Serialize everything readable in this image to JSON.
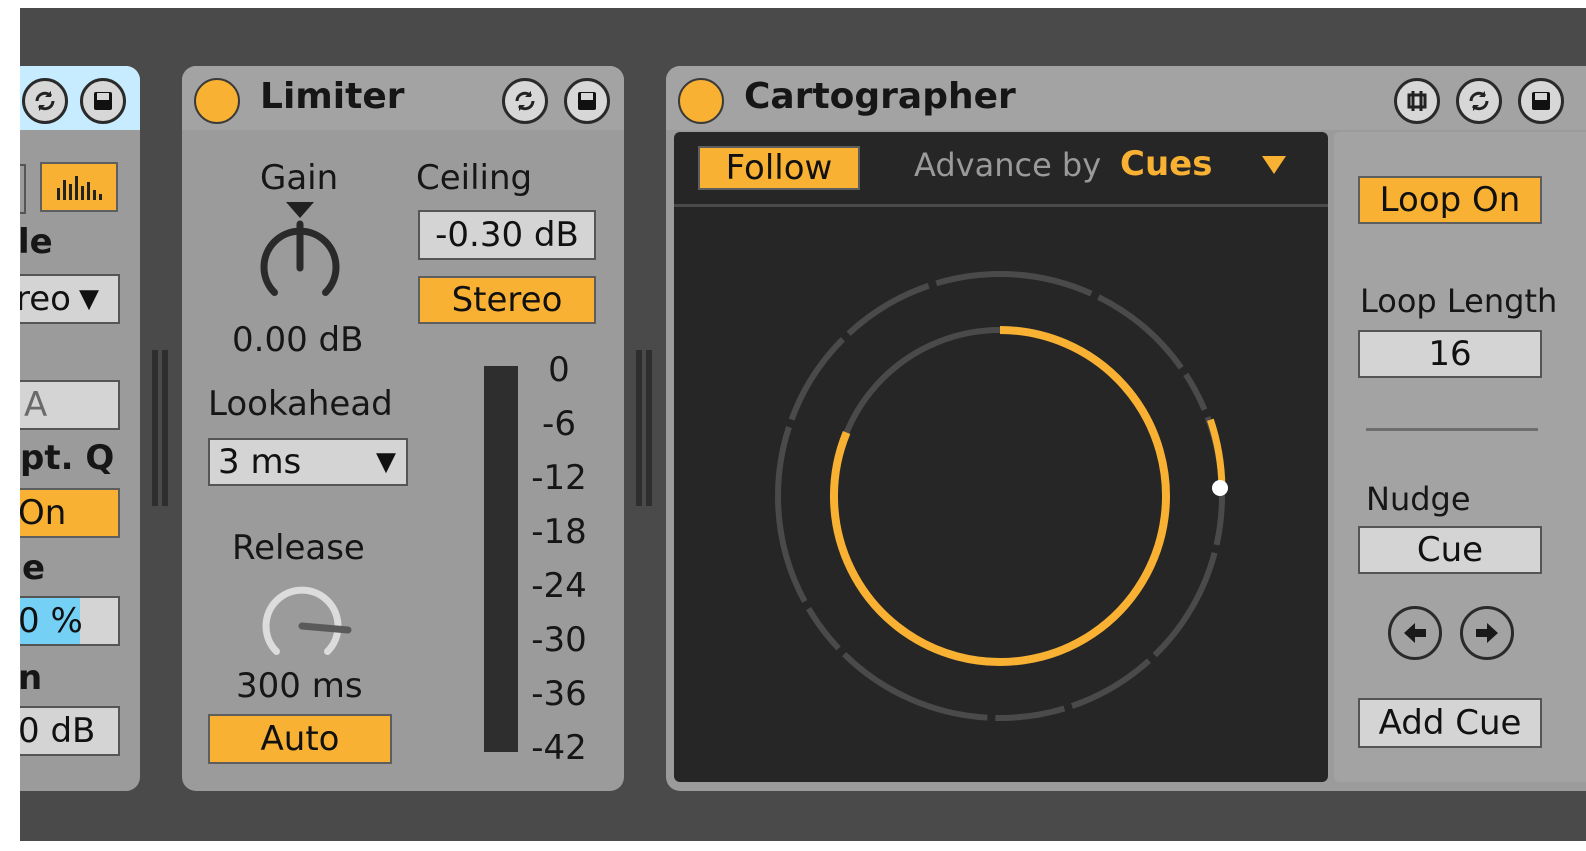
{
  "left_device": {
    "mode_label_partial": "le",
    "mode_select_partial": "reo",
    "field_partial": "A",
    "adapt_label_partial": "pt. Q",
    "adapt_toggle_partial": "On",
    "scale_label_partial": "e",
    "scale_value_partial": "0 %",
    "gain_label_partial": "n",
    "gain_value_partial": "0 dB"
  },
  "limiter": {
    "title": "Limiter",
    "gain_label": "Gain",
    "gain_value": "0.00 dB",
    "ceiling_label": "Ceiling",
    "ceiling_value": "-0.30 dB",
    "stereo_button": "Stereo",
    "lookahead_label": "Lookahead",
    "lookahead_value": "3 ms",
    "release_label": "Release",
    "release_value": "300 ms",
    "auto_button": "Auto",
    "meter_ticks": [
      "0",
      "-6",
      "-12",
      "-18",
      "-24",
      "-30",
      "-36",
      "-42"
    ]
  },
  "cartographer": {
    "title": "Cartographer",
    "follow_button": "Follow",
    "advance_label": "Advance by",
    "advance_value": "Cues",
    "loop_button": "Loop On",
    "loop_length_label": "Loop Length",
    "loop_length_value": "16",
    "nudge_label": "Nudge",
    "nudge_value": "Cue",
    "add_cue_button": "Add Cue"
  },
  "colors": {
    "accent": "#f8b133",
    "panel": "#9b9b9b",
    "background": "#4a4a4a",
    "display": "#262626",
    "selected_blue": "#c8ecff"
  }
}
